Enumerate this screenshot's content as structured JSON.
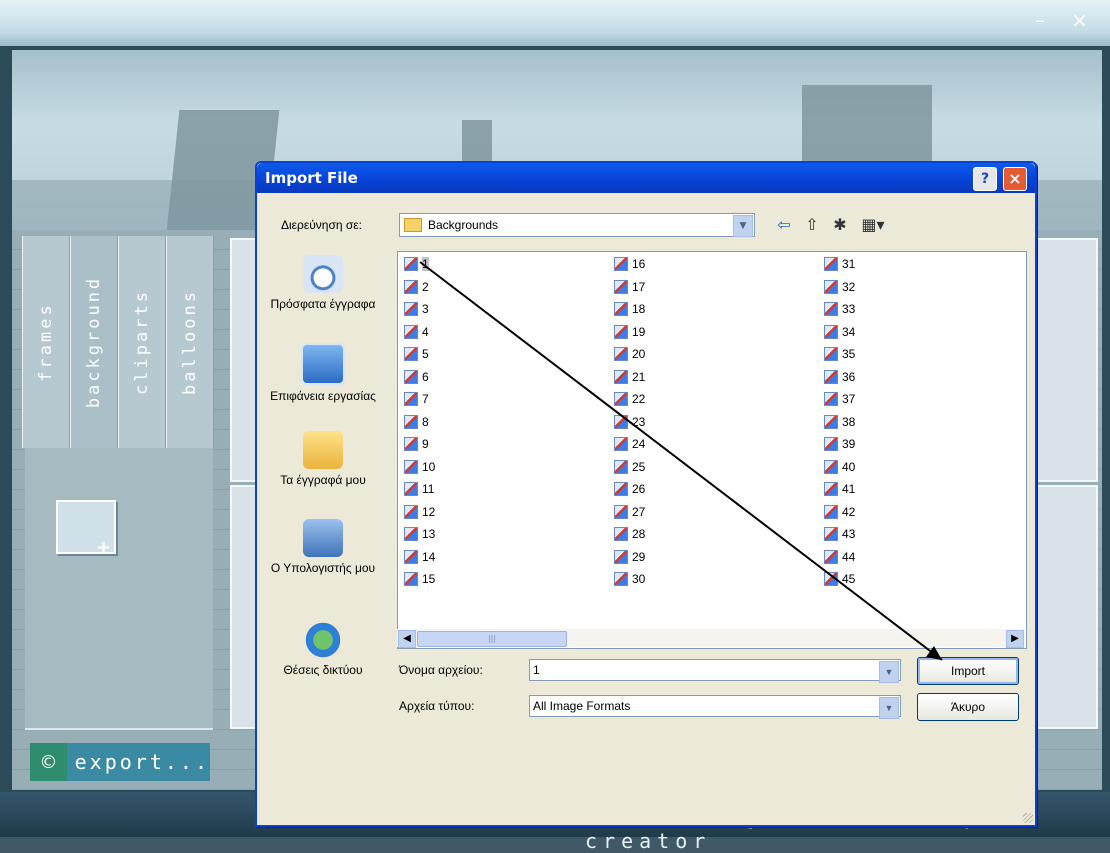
{
  "app": {
    "window_controls": {
      "minimize": "–",
      "close": "×"
    },
    "sidebar_tabs": [
      "frames",
      "background",
      "cliparts",
      "balloons"
    ],
    "export_label": "export...",
    "export_icon": "©",
    "about_label": "About cosy comic strip creator"
  },
  "dialog": {
    "title": "Import File",
    "help_label": "?",
    "close_label": "×",
    "look_in_label": "Διερεύνηση σε:",
    "look_in_value": "Backgrounds",
    "toolbar_icons": [
      "back-arrow-icon",
      "up-folder-icon",
      "new-folder-icon",
      "view-menu-icon"
    ],
    "places": [
      {
        "label": "Πρόσφατα έγγραφα",
        "icon": "recent-documents-icon"
      },
      {
        "label": "Επιφάνεια εργασίας",
        "icon": "desktop-icon"
      },
      {
        "label": "Τα έγγραφά μου",
        "icon": "my-documents-icon"
      },
      {
        "label": "Ο Υπολογιστής μου",
        "icon": "my-computer-icon"
      },
      {
        "label": "Θέσεις δικτύου",
        "icon": "network-places-icon"
      }
    ],
    "files": [
      "1",
      "2",
      "3",
      "4",
      "5",
      "6",
      "7",
      "8",
      "9",
      "10",
      "11",
      "12",
      "13",
      "14",
      "15",
      "16",
      "17",
      "18",
      "19",
      "20",
      "21",
      "22",
      "23",
      "24",
      "25",
      "26",
      "27",
      "28",
      "29",
      "30",
      "31",
      "32",
      "33",
      "34",
      "35",
      "36",
      "37",
      "38",
      "39",
      "40",
      "41",
      "42",
      "43",
      "44",
      "45"
    ],
    "selected_file": "1",
    "filename_label": "Όνομα αρχείου:",
    "filename_value": "1",
    "filetype_label": "Αρχεία τύπου:",
    "filetype_value": "All Image Formats",
    "import_label": "Import",
    "cancel_label": "Άκυρο"
  },
  "colors": {
    "xp_blue": "#0841d6",
    "dialog_bg": "#ece9d8",
    "app_teal": "#2c4b59"
  }
}
